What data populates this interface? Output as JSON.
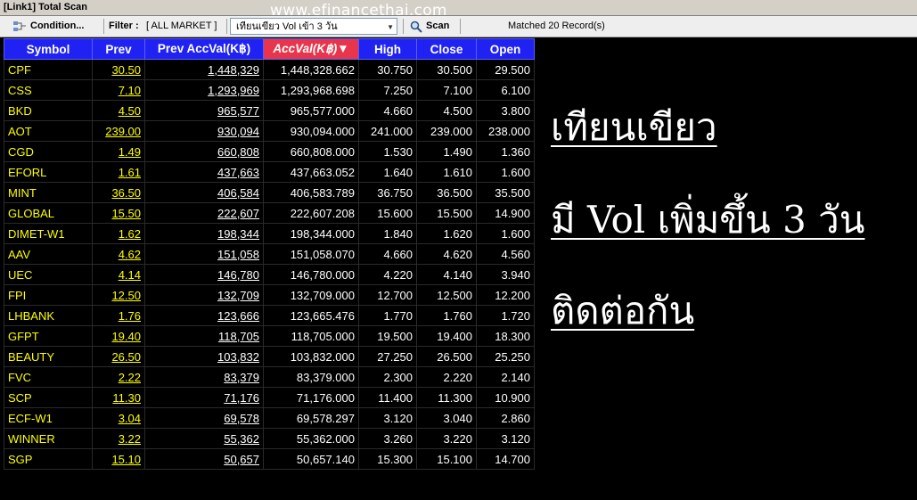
{
  "window": {
    "title": "[Link1] Total Scan"
  },
  "watermark": "www.efinancethai.com",
  "toolbar": {
    "condition_label": "Condition...",
    "filter_label": "Filter :",
    "filter_value": "[ ALL MARKET ]",
    "filter_select": "เทียนเขียว Vol เข้า 3 วัน",
    "scan_label": "Scan",
    "matched_text": "Matched 20 Record(s)"
  },
  "table": {
    "headers": [
      "Symbol",
      "Prev",
      "Prev AccVal(K฿)",
      "AccVal(K฿)",
      "High",
      "Close",
      "Open"
    ],
    "sorted_column": 3,
    "rows": [
      [
        "CPF",
        "30.50",
        "1,448,329",
        "1,448,328.662",
        "30.750",
        "30.500",
        "29.500"
      ],
      [
        "CSS",
        "7.10",
        "1,293,969",
        "1,293,968.698",
        "7.250",
        "7.100",
        "6.100"
      ],
      [
        "BKD",
        "4.50",
        "965,577",
        "965,577.000",
        "4.660",
        "4.500",
        "3.800"
      ],
      [
        "AOT",
        "239.00",
        "930,094",
        "930,094.000",
        "241.000",
        "239.000",
        "238.000"
      ],
      [
        "CGD",
        "1.49",
        "660,808",
        "660,808.000",
        "1.530",
        "1.490",
        "1.360"
      ],
      [
        "EFORL",
        "1.61",
        "437,663",
        "437,663.052",
        "1.640",
        "1.610",
        "1.600"
      ],
      [
        "MINT",
        "36.50",
        "406,584",
        "406,583.789",
        "36.750",
        "36.500",
        "35.500"
      ],
      [
        "GLOBAL",
        "15.50",
        "222,607",
        "222,607.208",
        "15.600",
        "15.500",
        "14.900"
      ],
      [
        "DIMET-W1",
        "1.62",
        "198,344",
        "198,344.000",
        "1.840",
        "1.620",
        "1.600"
      ],
      [
        "AAV",
        "4.62",
        "151,058",
        "151,058.070",
        "4.660",
        "4.620",
        "4.560"
      ],
      [
        "UEC",
        "4.14",
        "146,780",
        "146,780.000",
        "4.220",
        "4.140",
        "3.940"
      ],
      [
        "FPI",
        "12.50",
        "132,709",
        "132,709.000",
        "12.700",
        "12.500",
        "12.200"
      ],
      [
        "LHBANK",
        "1.76",
        "123,666",
        "123,665.476",
        "1.770",
        "1.760",
        "1.720"
      ],
      [
        "GFPT",
        "19.40",
        "118,705",
        "118,705.000",
        "19.500",
        "19.400",
        "18.300"
      ],
      [
        "BEAUTY",
        "26.50",
        "103,832",
        "103,832.000",
        "27.250",
        "26.500",
        "25.250"
      ],
      [
        "FVC",
        "2.22",
        "83,379",
        "83,379.000",
        "2.300",
        "2.220",
        "2.140"
      ],
      [
        "SCP",
        "11.30",
        "71,176",
        "71,176.000",
        "11.400",
        "11.300",
        "10.900"
      ],
      [
        "ECF-W1",
        "3.04",
        "69,578",
        "69,578.297",
        "3.120",
        "3.040",
        "2.860"
      ],
      [
        "WINNER",
        "3.22",
        "55,362",
        "55,362.000",
        "3.260",
        "3.220",
        "3.120"
      ],
      [
        "SGP",
        "15.10",
        "50,657",
        "50,657.140",
        "15.300",
        "15.100",
        "14.700"
      ]
    ]
  },
  "overlay_text": [
    "เทียนเขียว",
    "มี Vol เพิ่มขึ้น 3 วัน",
    "ติดต่อกัน"
  ],
  "colors": {
    "header_bg": "#1f22f2",
    "sorted_header_bg": "#e8354c",
    "symbol_text": "#ffff00",
    "background": "#000000"
  }
}
